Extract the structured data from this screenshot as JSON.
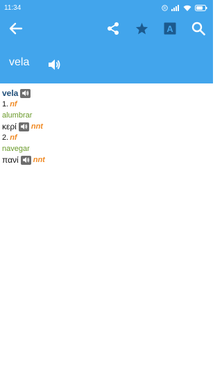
{
  "status": {
    "time": "11:34"
  },
  "appbar": {
    "back_icon": "arrow-left-icon",
    "share_icon": "share-icon",
    "favorite_icon": "star-icon",
    "font_icon": "font-a-icon",
    "search_icon": "search-icon",
    "color": "#42a5ec"
  },
  "headword": {
    "text": "vela",
    "speaker_icon": "speaker-icon"
  },
  "entry": {
    "word": "vela",
    "senses": [
      {
        "number": "1.",
        "pos": "nf",
        "note": "alumbrar",
        "translation": "κερί",
        "translation_pos": "nnt"
      },
      {
        "number": "2.",
        "pos": "nf",
        "note": "navegar",
        "translation": "πανί",
        "translation_pos": "nnt"
      }
    ]
  }
}
